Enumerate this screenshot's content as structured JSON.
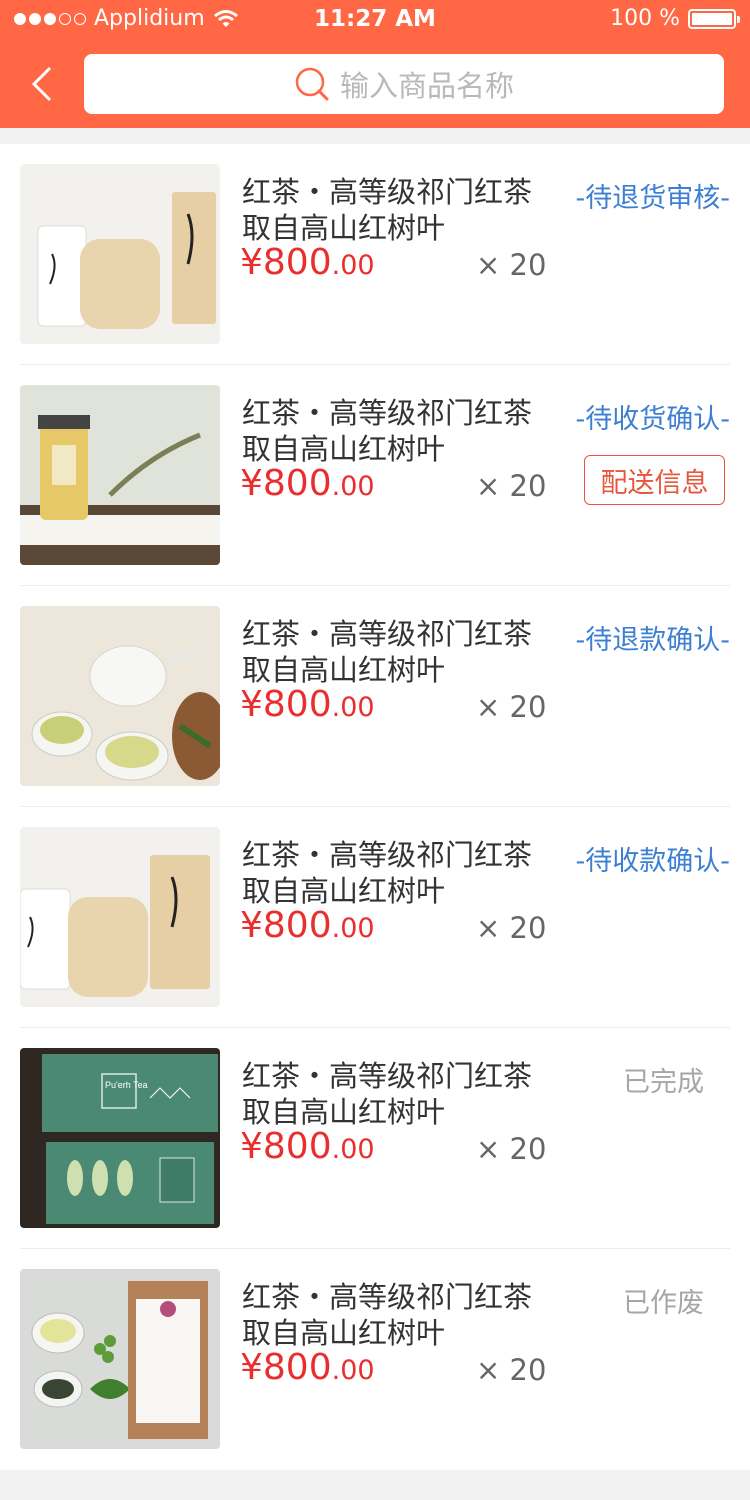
{
  "status_bar": {
    "carrier": "Applidium",
    "time": "11:27 AM",
    "battery": "100 %"
  },
  "header": {
    "back_icon": "chevron-left-icon",
    "search_placeholder": "输入商品名称",
    "search_icon": "search-icon"
  },
  "colors": {
    "brand": "#ff6745",
    "price": "#ea2e2e",
    "status_blue": "#3d7fd3",
    "status_gray": "#a6a6a6"
  },
  "orders": [
    {
      "title_line1": "红茶・高等级祁门红茶",
      "title_line2": "取自高山红树叶",
      "price_int": "¥800",
      "price_dec": ".00",
      "qty": "× 20",
      "status": "-待退货审核-"
    },
    {
      "title_line1": "红茶・高等级祁门红茶",
      "title_line2": "取自高山红树叶",
      "price_int": "¥800",
      "price_dec": ".00",
      "qty": "× 20",
      "status": "-待收货确认-",
      "action": "配送信息"
    },
    {
      "title_line1": "红茶・高等级祁门红茶",
      "title_line2": "取自高山红树叶",
      "price_int": "¥800",
      "price_dec": ".00",
      "qty": "× 20",
      "status": "-待退款确认-"
    },
    {
      "title_line1": "红茶・高等级祁门红茶",
      "title_line2": "取自高山红树叶",
      "price_int": "¥800",
      "price_dec": ".00",
      "qty": "× 20",
      "status": "-待收款确认-"
    },
    {
      "title_line1": "红茶・高等级祁门红茶",
      "title_line2": "取自高山红树叶",
      "price_int": "¥800",
      "price_dec": ".00",
      "qty": "× 20",
      "status": "已完成"
    },
    {
      "title_line1": "红茶・高等级祁门红茶",
      "title_line2": "取自高山红树叶",
      "price_int": "¥800",
      "price_dec": ".00",
      "qty": "× 20",
      "status": "已作废"
    }
  ],
  "thumbnails": [
    {
      "image_label": "Pu'erh Tea"
    }
  ]
}
